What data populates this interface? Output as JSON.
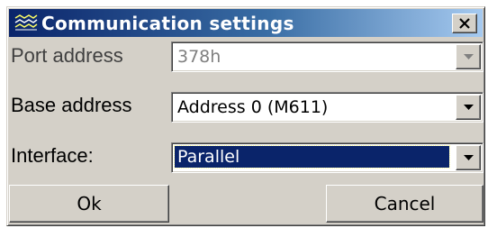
{
  "window": {
    "title": "Communication settings",
    "icon": "network-icon",
    "close_icon": "close-icon"
  },
  "fields": {
    "port_address": {
      "label": "Port address",
      "value": "378h",
      "enabled": false
    },
    "base_address": {
      "label": "Base address",
      "value": "Address 0 (M611)",
      "enabled": true
    },
    "interface": {
      "label": "Interface:",
      "value": "Parallel",
      "enabled": true,
      "focused": true
    }
  },
  "buttons": {
    "ok_label": "Ok",
    "cancel_label": "Cancel"
  },
  "colors": {
    "title_bar_start": "#0a246a",
    "title_bar_end": "#a6caf0",
    "face": "#d4d0c8",
    "selection": "#0a246a"
  }
}
